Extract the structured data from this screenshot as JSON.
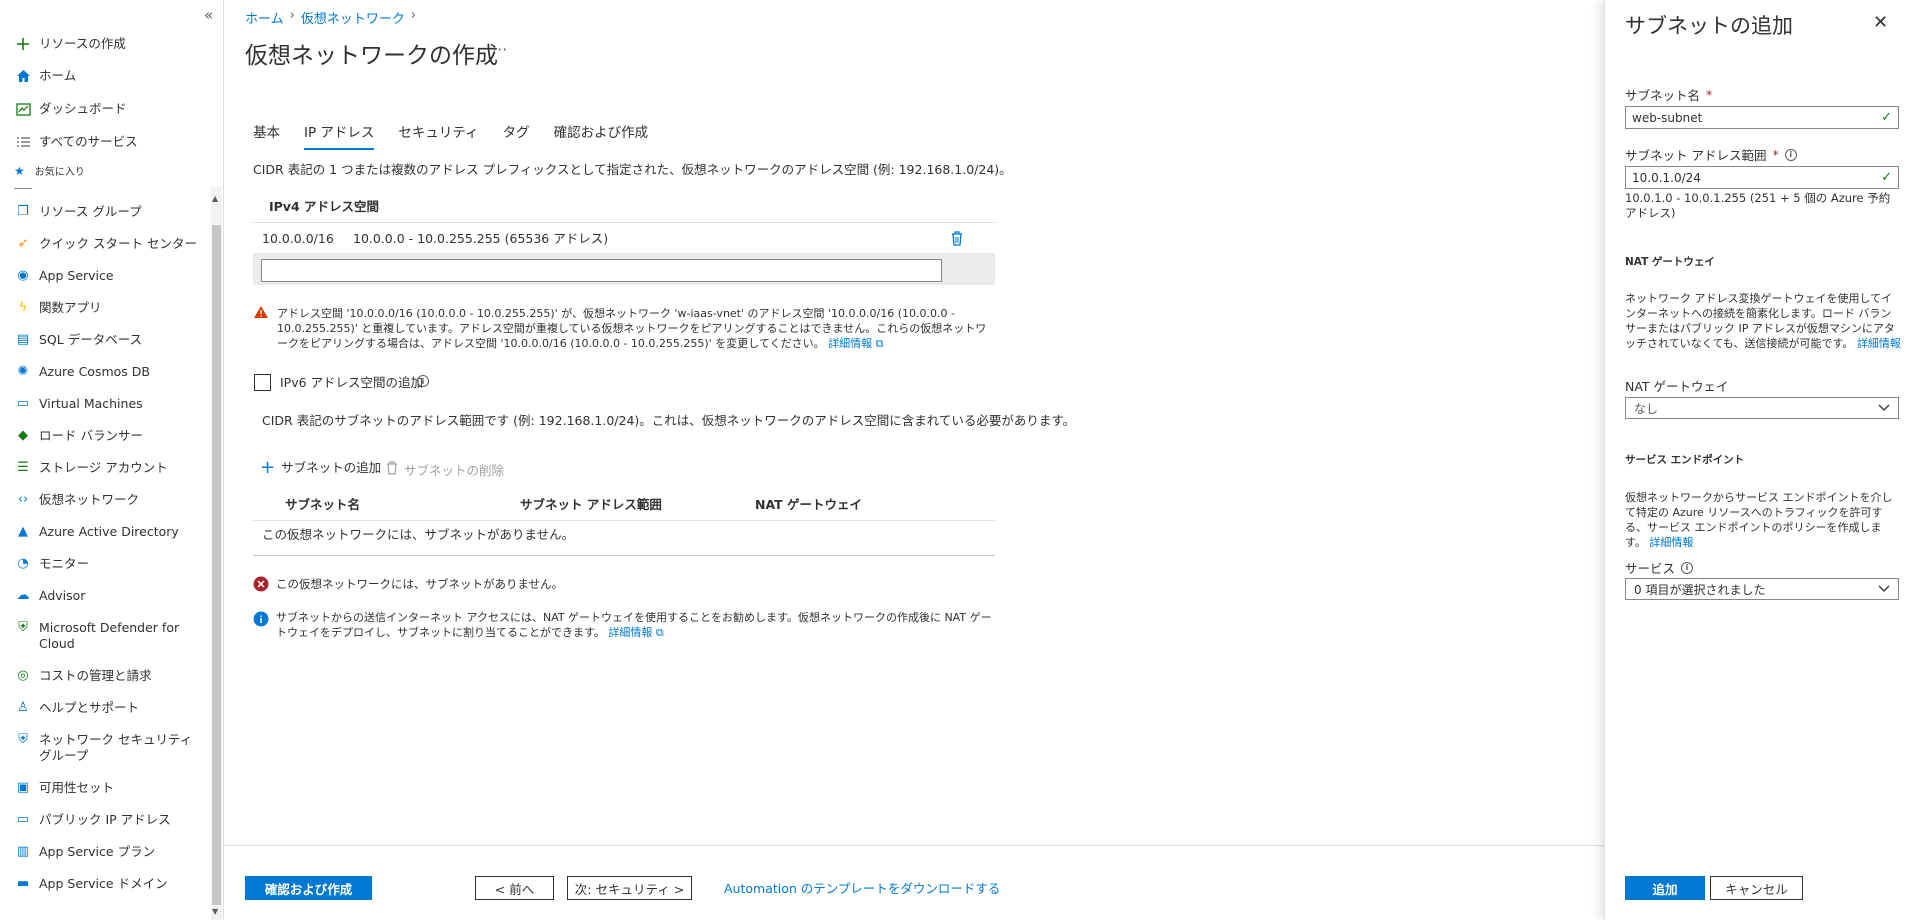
{
  "sidebar": {
    "collapse": "«",
    "items": [
      {
        "label": "リソースの作成",
        "icon": "plus-icon",
        "color": "#107c10"
      },
      {
        "label": "ホーム",
        "icon": "home-icon",
        "color": "#0078d4"
      },
      {
        "label": "ダッシュボード",
        "icon": "dashboard-icon",
        "color": "#107c10"
      },
      {
        "label": "すべてのサービス",
        "icon": "list-icon",
        "color": "#605e5c"
      }
    ],
    "favorites_label": "お気に入り",
    "favorites": [
      {
        "label": "リソース グループ",
        "icon": "resource-group-icon",
        "color": "#0078d4"
      },
      {
        "label": "クイック スタート センター",
        "icon": "rocket-icon",
        "color": "#ff8c00"
      },
      {
        "label": "App Service",
        "icon": "app-service-icon",
        "color": "#0078d4"
      },
      {
        "label": "関数アプリ",
        "icon": "function-app-icon",
        "color": "#ffb900"
      },
      {
        "label": "SQL データベース",
        "icon": "sql-database-icon",
        "color": "#0078d4"
      },
      {
        "label": "Azure Cosmos DB",
        "icon": "cosmos-db-icon",
        "color": "#0078d4"
      },
      {
        "label": "Virtual Machines",
        "icon": "virtual-machine-icon",
        "color": "#0078d4"
      },
      {
        "label": "ロード バランサー",
        "icon": "load-balancer-icon",
        "color": "#107c10"
      },
      {
        "label": "ストレージ アカウント",
        "icon": "storage-account-icon",
        "color": "#107c10"
      },
      {
        "label": "仮想ネットワーク",
        "icon": "virtual-network-icon",
        "color": "#0078d4"
      },
      {
        "label": "Azure Active Directory",
        "icon": "active-directory-icon",
        "color": "#0078d4"
      },
      {
        "label": "モニター",
        "icon": "monitor-icon",
        "color": "#0078d4"
      },
      {
        "label": "Advisor",
        "icon": "advisor-icon",
        "color": "#0078d4"
      },
      {
        "label": "Microsoft Defender for Cloud",
        "icon": "defender-icon",
        "color": "#107c10"
      },
      {
        "label": "コストの管理と請求",
        "icon": "cost-management-icon",
        "color": "#107c10"
      },
      {
        "label": "ヘルプとサポート",
        "icon": "help-support-icon",
        "color": "#0078d4"
      },
      {
        "label": "ネットワーク セキュリティ グループ",
        "icon": "network-security-group-icon",
        "color": "#0078d4"
      },
      {
        "label": "可用性セット",
        "icon": "availability-set-icon",
        "color": "#0078d4"
      },
      {
        "label": "パブリック IP アドレス",
        "icon": "public-ip-icon",
        "color": "#0078d4"
      },
      {
        "label": "App Service プラン",
        "icon": "app-service-plan-icon",
        "color": "#0078d4"
      },
      {
        "label": "App Service ドメイン",
        "icon": "app-service-domain-icon",
        "color": "#0078d4"
      }
    ]
  },
  "breadcrumb": [
    "ホーム",
    "仮想ネットワーク"
  ],
  "page_title": "仮想ネットワークの作成",
  "ellipsis": "···",
  "tabs": [
    "基本",
    "IP アドレス",
    "セキュリティ",
    "タグ",
    "確認および作成"
  ],
  "ip": {
    "description": "CIDR 表記の 1 つまたは複数のアドレス プレフィックスとして指定された、仮想ネットワークのアドレス空間 (例: 192.168.1.0/24)。",
    "ipv4_header": "IPv4 アドレス空間",
    "address_prefix": "10.0.0.0/16",
    "address_range": "10.0.0.0 - 10.0.255.255 (65536 アドレス)",
    "new_address_value": "",
    "warning_text": "アドレス空間 '10.0.0.0/16 (10.0.0.0 - 10.0.255.255)' が、仮想ネットワーク 'w-iaas-vnet' のアドレス空間 '10.0.0.0/16 (10.0.0.0 - 10.0.255.255)' と重複しています。アドレス空間が重複している仮想ネットワークをピアリングすることはできません。これらの仮想ネットワークをピアリングする場合は、アドレス空間 '10.0.0.0/16 (10.0.0.0 - 10.0.255.255)' を変更してください。",
    "warning_link": "詳細情報",
    "ipv6_label": "IPv6 アドレス空間の追加",
    "subnet_description": "CIDR 表記のサブネットのアドレス範囲です (例: 192.168.1.0/24)。これは、仮想ネットワークのアドレス空間に含まれている必要があります。",
    "add_subnet": "サブネットの追加",
    "delete_subnet": "サブネットの削除",
    "columns": [
      "サブネット名",
      "サブネット アドレス範囲",
      "NAT ゲートウェイ"
    ],
    "empty_row": "この仮想ネットワークには、サブネットがありません。",
    "error_text": "この仮想ネットワークには、サブネットがありません。",
    "info_text": "サブネットからの送信インターネット アクセスには、NAT ゲートウェイを使用することをお勧めします。仮想ネットワークの作成後に NAT ゲートウェイをデプロイし、サブネットに割り当てることができます。",
    "info_link": "詳細情報"
  },
  "footer": {
    "review_create": "確認および作成",
    "previous": "< 前へ",
    "next": "次: セキュリティ >",
    "download_template": "Automation のテンプレートをダウンロードする"
  },
  "panel": {
    "title": "サブネットの追加",
    "subnet_name_label": "サブネット名",
    "subnet_name_value": "web-subnet",
    "subnet_range_label": "サブネット アドレス範囲",
    "subnet_range_value": "10.0.1.0/24",
    "subnet_range_hint": "10.0.1.0 - 10.0.1.255 (251 + 5 個の Azure 予約アドレス)",
    "nat_section": "NAT ゲートウェイ",
    "nat_desc": "ネットワーク アドレス変換ゲートウェイを使用してインターネットへの接続を簡素化します。ロード バランサーまたはパブリック IP アドレスが仮想マシンにアタッチされていなくても、送信接続が可能です。",
    "nat_link": "詳細情報",
    "nat_label": "NAT ゲートウェイ",
    "nat_value": "なし",
    "endpoint_section": "サービス エンドポイント",
    "endpoint_desc": "仮想ネットワークからサービス エンドポイントを介して特定の Azure リソースへのトラフィックを許可する、サービス エンドポイントのポリシーを作成します。",
    "endpoint_link": "詳細情報",
    "services_label": "サービス",
    "services_value": "0 項目が選択されました",
    "add_button": "追加",
    "cancel_button": "キャンセル"
  },
  "colors": {
    "accent": "#0078d4",
    "warning": "#d83b01",
    "error": "#a4262c",
    "success": "#107c10"
  }
}
